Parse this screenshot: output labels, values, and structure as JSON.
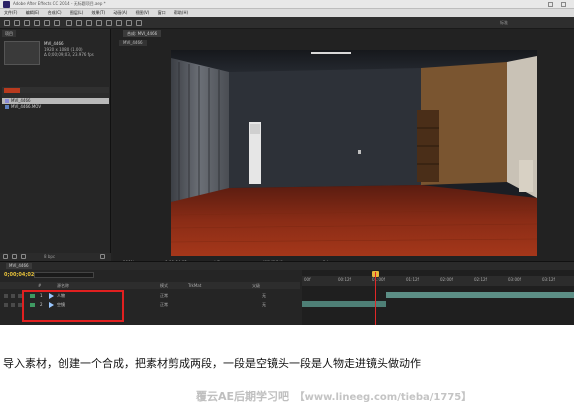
{
  "app": {
    "title": "Adobe After Effects CC 2014 - 无标题项目.aep *",
    "menu": [
      "文件(F)",
      "编辑(E)",
      "合成(C)",
      "图层(L)",
      "效果(T)",
      "动画(A)",
      "视图(V)",
      "窗口",
      "帮助(H)"
    ],
    "workspace": "标准"
  },
  "project_panel": {
    "tab": "项目",
    "item_name": "MVI_4466",
    "item_info": [
      "1920 x 1080 (1.00)",
      "Δ 0;00;09;03, 23.976 fps"
    ],
    "bpc": "8 bpc",
    "items": [
      {
        "name": "MVI_4466",
        "type": "comp"
      },
      {
        "name": "MVI_4466.MOV",
        "type": "footage"
      }
    ]
  },
  "comp_panel": {
    "tab": "合成: MVI_4466",
    "sub_tab": "MVI_4466",
    "zoom": "100%",
    "timecode": "0;00;04;02",
    "resolution": "完整",
    "camera": "活动摄像机",
    "views": "1个"
  },
  "timeline": {
    "tab": "MVI_4466",
    "current_time": "0;00;04;02",
    "search_placeholder": "ρ▾",
    "column_headers": {
      "num": "#",
      "source": "源名称",
      "mode": "模式",
      "trkmat": "TrkMat",
      "parent": "父级"
    },
    "layers": [
      {
        "index": "1",
        "name": "人物",
        "mode": "正常",
        "parent": "无"
      },
      {
        "index": "2",
        "name": "空镜",
        "mode": "正常",
        "parent": "无"
      }
    ],
    "ruler_labels": [
      "00f",
      "00:12f",
      "01:00f",
      "01:12f",
      "02:00f",
      "02:12f",
      "03:00f",
      "03:12f"
    ]
  },
  "colors": {
    "highlight_box": "#e12020",
    "playhead": "#e02828",
    "time_display": "#e6c13a",
    "layer_label": "#3f9a62"
  },
  "caption": "导入素材，创建一个合成，把素材剪成两段，一段是空镜头一段是人物走进镜头做动作",
  "watermark": {
    "brand": "覆云AE后期学习吧",
    "url": "【www.lineeg.com/tieba/1775】"
  }
}
